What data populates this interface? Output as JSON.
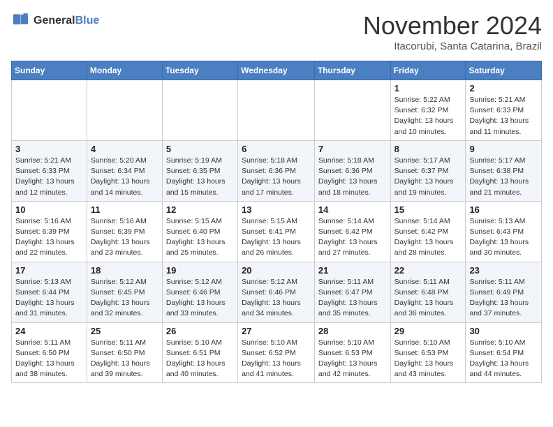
{
  "header": {
    "logo_general": "General",
    "logo_blue": "Blue",
    "month_title": "November 2024",
    "location": "Itacorubi, Santa Catarina, Brazil"
  },
  "days_of_week": [
    "Sunday",
    "Monday",
    "Tuesday",
    "Wednesday",
    "Thursday",
    "Friday",
    "Saturday"
  ],
  "weeks": [
    [
      {
        "day": "",
        "info": ""
      },
      {
        "day": "",
        "info": ""
      },
      {
        "day": "",
        "info": ""
      },
      {
        "day": "",
        "info": ""
      },
      {
        "day": "",
        "info": ""
      },
      {
        "day": "1",
        "info": "Sunrise: 5:22 AM\nSunset: 6:32 PM\nDaylight: 13 hours and 10 minutes."
      },
      {
        "day": "2",
        "info": "Sunrise: 5:21 AM\nSunset: 6:33 PM\nDaylight: 13 hours and 11 minutes."
      }
    ],
    [
      {
        "day": "3",
        "info": "Sunrise: 5:21 AM\nSunset: 6:33 PM\nDaylight: 13 hours and 12 minutes."
      },
      {
        "day": "4",
        "info": "Sunrise: 5:20 AM\nSunset: 6:34 PM\nDaylight: 13 hours and 14 minutes."
      },
      {
        "day": "5",
        "info": "Sunrise: 5:19 AM\nSunset: 6:35 PM\nDaylight: 13 hours and 15 minutes."
      },
      {
        "day": "6",
        "info": "Sunrise: 5:18 AM\nSunset: 6:36 PM\nDaylight: 13 hours and 17 minutes."
      },
      {
        "day": "7",
        "info": "Sunrise: 5:18 AM\nSunset: 6:36 PM\nDaylight: 13 hours and 18 minutes."
      },
      {
        "day": "8",
        "info": "Sunrise: 5:17 AM\nSunset: 6:37 PM\nDaylight: 13 hours and 19 minutes."
      },
      {
        "day": "9",
        "info": "Sunrise: 5:17 AM\nSunset: 6:38 PM\nDaylight: 13 hours and 21 minutes."
      }
    ],
    [
      {
        "day": "10",
        "info": "Sunrise: 5:16 AM\nSunset: 6:39 PM\nDaylight: 13 hours and 22 minutes."
      },
      {
        "day": "11",
        "info": "Sunrise: 5:16 AM\nSunset: 6:39 PM\nDaylight: 13 hours and 23 minutes."
      },
      {
        "day": "12",
        "info": "Sunrise: 5:15 AM\nSunset: 6:40 PM\nDaylight: 13 hours and 25 minutes."
      },
      {
        "day": "13",
        "info": "Sunrise: 5:15 AM\nSunset: 6:41 PM\nDaylight: 13 hours and 26 minutes."
      },
      {
        "day": "14",
        "info": "Sunrise: 5:14 AM\nSunset: 6:42 PM\nDaylight: 13 hours and 27 minutes."
      },
      {
        "day": "15",
        "info": "Sunrise: 5:14 AM\nSunset: 6:42 PM\nDaylight: 13 hours and 28 minutes."
      },
      {
        "day": "16",
        "info": "Sunrise: 5:13 AM\nSunset: 6:43 PM\nDaylight: 13 hours and 30 minutes."
      }
    ],
    [
      {
        "day": "17",
        "info": "Sunrise: 5:13 AM\nSunset: 6:44 PM\nDaylight: 13 hours and 31 minutes."
      },
      {
        "day": "18",
        "info": "Sunrise: 5:12 AM\nSunset: 6:45 PM\nDaylight: 13 hours and 32 minutes."
      },
      {
        "day": "19",
        "info": "Sunrise: 5:12 AM\nSunset: 6:46 PM\nDaylight: 13 hours and 33 minutes."
      },
      {
        "day": "20",
        "info": "Sunrise: 5:12 AM\nSunset: 6:46 PM\nDaylight: 13 hours and 34 minutes."
      },
      {
        "day": "21",
        "info": "Sunrise: 5:11 AM\nSunset: 6:47 PM\nDaylight: 13 hours and 35 minutes."
      },
      {
        "day": "22",
        "info": "Sunrise: 5:11 AM\nSunset: 6:48 PM\nDaylight: 13 hours and 36 minutes."
      },
      {
        "day": "23",
        "info": "Sunrise: 5:11 AM\nSunset: 6:49 PM\nDaylight: 13 hours and 37 minutes."
      }
    ],
    [
      {
        "day": "24",
        "info": "Sunrise: 5:11 AM\nSunset: 6:50 PM\nDaylight: 13 hours and 38 minutes."
      },
      {
        "day": "25",
        "info": "Sunrise: 5:11 AM\nSunset: 6:50 PM\nDaylight: 13 hours and 39 minutes."
      },
      {
        "day": "26",
        "info": "Sunrise: 5:10 AM\nSunset: 6:51 PM\nDaylight: 13 hours and 40 minutes."
      },
      {
        "day": "27",
        "info": "Sunrise: 5:10 AM\nSunset: 6:52 PM\nDaylight: 13 hours and 41 minutes."
      },
      {
        "day": "28",
        "info": "Sunrise: 5:10 AM\nSunset: 6:53 PM\nDaylight: 13 hours and 42 minutes."
      },
      {
        "day": "29",
        "info": "Sunrise: 5:10 AM\nSunset: 6:53 PM\nDaylight: 13 hours and 43 minutes."
      },
      {
        "day": "30",
        "info": "Sunrise: 5:10 AM\nSunset: 6:54 PM\nDaylight: 13 hours and 44 minutes."
      }
    ]
  ]
}
